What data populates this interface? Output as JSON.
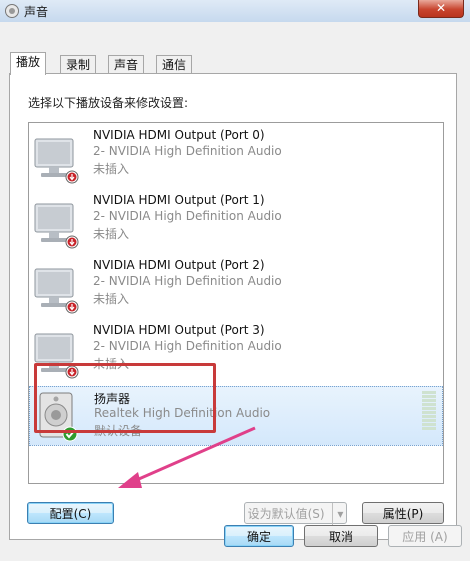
{
  "window": {
    "title": "声音",
    "close_label": "✕"
  },
  "tabs": [
    {
      "label": "播放",
      "active": true
    },
    {
      "label": "录制",
      "active": false
    },
    {
      "label": "声音",
      "active": false
    },
    {
      "label": "通信",
      "active": false
    }
  ],
  "instruction": "选择以下播放设备来修改设置:",
  "devices": [
    {
      "name": "NVIDIA HDMI Output (Port 0)",
      "desc": "2- NVIDIA High Definition Audio",
      "status": "未插入",
      "icon": "monitor-icon"
    },
    {
      "name": "NVIDIA HDMI Output (Port 1)",
      "desc": "2- NVIDIA High Definition Audio",
      "status": "未插入",
      "icon": "monitor-icon"
    },
    {
      "name": "NVIDIA HDMI Output (Port 2)",
      "desc": "2- NVIDIA High Definition Audio",
      "status": "未插入",
      "icon": "monitor-icon"
    },
    {
      "name": "NVIDIA HDMI Output (Port 3)",
      "desc": "2- NVIDIA High Definition Audio",
      "status": "未插入",
      "icon": "monitor-icon"
    },
    {
      "name": "扬声器",
      "desc": "Realtek High Definition Audio",
      "status": "默认设备",
      "icon": "speaker-icon",
      "selected": true
    }
  ],
  "buttons": {
    "configure": "配置(C)",
    "set_default": "设为默认值(S)",
    "properties": "属性(P)",
    "ok": "确定",
    "cancel": "取消",
    "apply": "应用 (A)"
  },
  "colors": {
    "highlight_box": "#c83a3a",
    "arrow": "#e0408a"
  }
}
